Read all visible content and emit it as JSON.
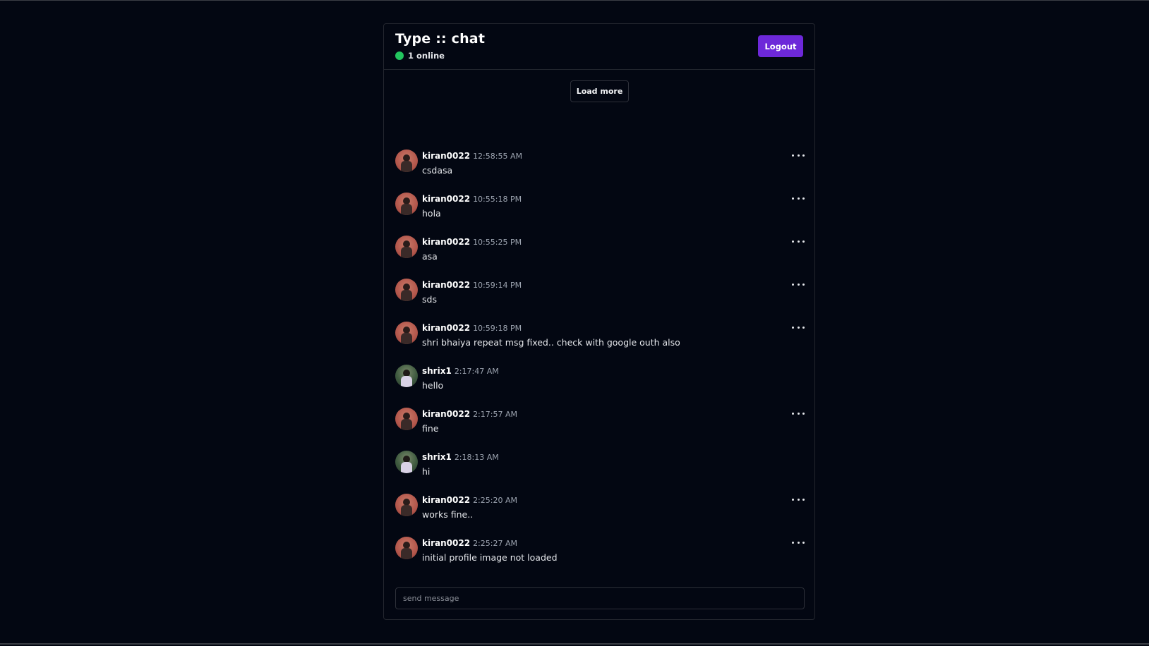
{
  "app": {
    "title": "Type :: chat",
    "online_text": "1 online",
    "logout_label": "Logout",
    "accent_color": "#6d28d9",
    "online_color": "#22c55e"
  },
  "load_more_label": "Load more",
  "messages": [
    {
      "username": "kiran0022",
      "time": "12:58:55 AM",
      "text": "csdasa",
      "avatar": "kiran",
      "has_menu": true
    },
    {
      "username": "kiran0022",
      "time": "10:55:18 PM",
      "text": "hola",
      "avatar": "kiran",
      "has_menu": true
    },
    {
      "username": "kiran0022",
      "time": "10:55:25 PM",
      "text": "asa",
      "avatar": "kiran",
      "has_menu": true
    },
    {
      "username": "kiran0022",
      "time": "10:59:14 PM",
      "text": "sds",
      "avatar": "kiran",
      "has_menu": true
    },
    {
      "username": "kiran0022",
      "time": "10:59:18 PM",
      "text": "shri bhaiya repeat msg fixed.. check with google outh also",
      "avatar": "kiran",
      "has_menu": true
    },
    {
      "username": "shrix1",
      "time": "2:17:47 AM",
      "text": "hello",
      "avatar": "shrix",
      "has_menu": false
    },
    {
      "username": "kiran0022",
      "time": "2:17:57 AM",
      "text": "fine",
      "avatar": "kiran",
      "has_menu": true
    },
    {
      "username": "shrix1",
      "time": "2:18:13 AM",
      "text": "hi",
      "avatar": "shrix",
      "has_menu": false
    },
    {
      "username": "kiran0022",
      "time": "2:25:20 AM",
      "text": "works fine..",
      "avatar": "kiran",
      "has_menu": true
    },
    {
      "username": "kiran0022",
      "time": "2:25:27 AM",
      "text": "initial profile image not loaded",
      "avatar": "kiran",
      "has_menu": true
    }
  ],
  "composer": {
    "placeholder": "send message",
    "value": ""
  }
}
